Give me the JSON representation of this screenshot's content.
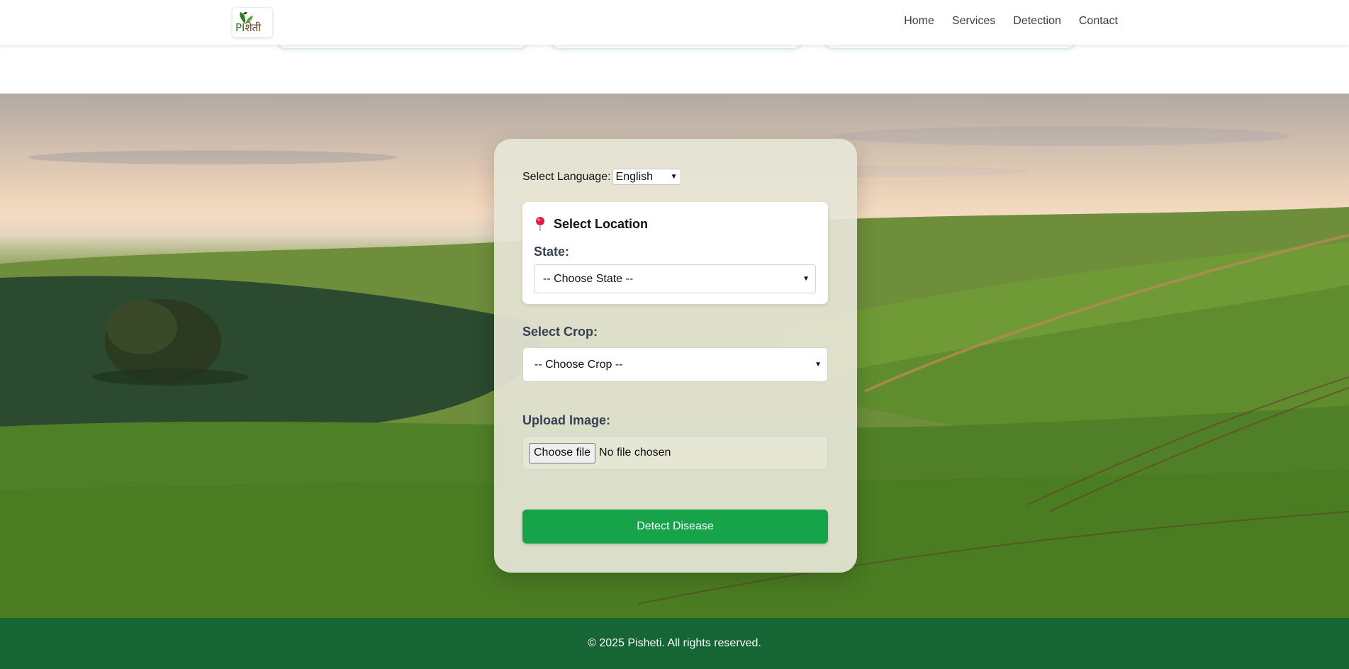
{
  "header": {
    "logo": {
      "text_prefix": "PI",
      "text_rest": "शेती",
      "icon": "leaf-logo-icon"
    },
    "nav": [
      "Home",
      "Services",
      "Detection",
      "Contact"
    ]
  },
  "form": {
    "language": {
      "label": "Select Language:",
      "selected": "English"
    },
    "location": {
      "icon": "pin-icon",
      "title": "Select Location",
      "state_label": "State:",
      "state_selected": "-- Choose State --"
    },
    "crop": {
      "label": "Select Crop:",
      "selected": "-- Choose Crop --"
    },
    "upload": {
      "label": "Upload Image:",
      "button": "Choose file",
      "status": "No file chosen"
    },
    "submit": "Detect Disease"
  },
  "footer": {
    "text": "© 2025 Pisheti. All rights reserved."
  },
  "colors": {
    "primary_green": "#16a34a",
    "footer_green": "#166534",
    "pin": "#e11d48"
  }
}
